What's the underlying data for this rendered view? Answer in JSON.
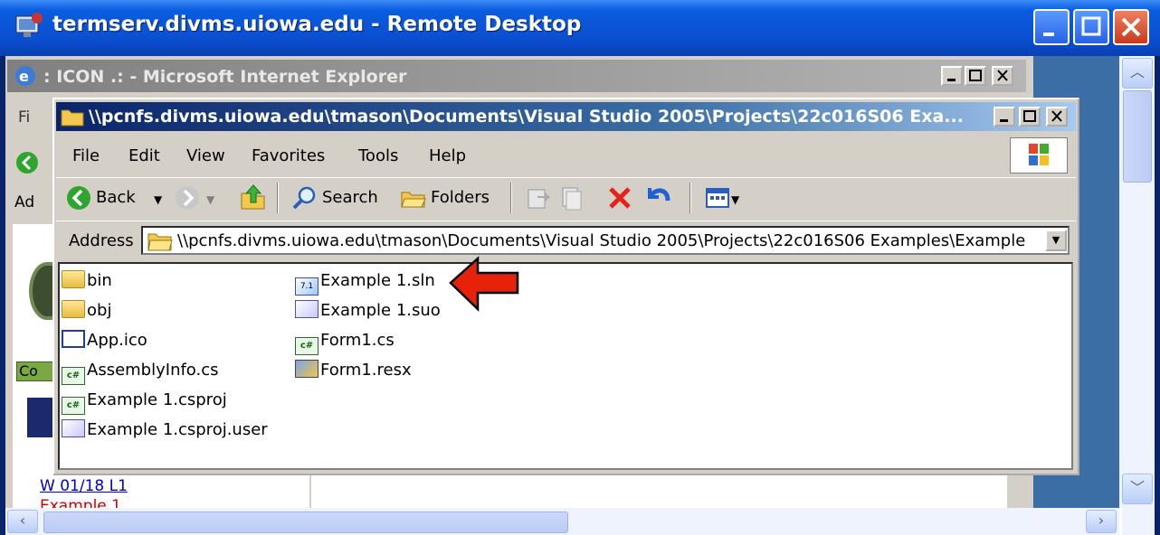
{
  "remote_desktop": {
    "title": "termserv.divms.uiowa.edu - Remote Desktop"
  },
  "ie_window": {
    "title": ": ICON .: - Microsoft Internet Explorer",
    "menu_peek": "Fi",
    "address_peek": "Ad",
    "green_label": "Co",
    "link_text": "W 01/18 L1",
    "red_text": "Example 1"
  },
  "explorer": {
    "title": "\\\\pcnfs.divms.uiowa.edu\\tmason\\Documents\\Visual Studio 2005\\Projects\\22c016S06 Exa...",
    "menu": [
      "File",
      "Edit",
      "View",
      "Favorites",
      "Tools",
      "Help"
    ],
    "toolbar": {
      "back": "Back",
      "search": "Search",
      "folders": "Folders"
    },
    "address_label": "Address",
    "address_value": "\\\\pcnfs.divms.uiowa.edu\\tmason\\Documents\\Visual Studio 2005\\Projects\\22c016S06 Examples\\Example",
    "files_col1": [
      {
        "name": "bin",
        "icon": "folder-icon"
      },
      {
        "name": "obj",
        "icon": "folder-icon"
      },
      {
        "name": "App.ico",
        "icon": "ico-file-icon"
      },
      {
        "name": "AssemblyInfo.cs",
        "icon": "csharp-file-icon"
      },
      {
        "name": "Example 1.csproj",
        "icon": "csproj-file-icon"
      },
      {
        "name": "Example 1.csproj.user",
        "icon": "user-file-icon"
      }
    ],
    "files_col2": [
      {
        "name": "Example 1.sln",
        "icon": "solution-file-icon"
      },
      {
        "name": "Example 1.suo",
        "icon": "suo-file-icon"
      },
      {
        "name": "Form1.cs",
        "icon": "csharp-file-icon"
      },
      {
        "name": "Form1.resx",
        "icon": "resx-file-icon"
      }
    ]
  },
  "annotation": {
    "arrow_color": "#e8220a",
    "arrow_target": "Example 1.sln"
  }
}
